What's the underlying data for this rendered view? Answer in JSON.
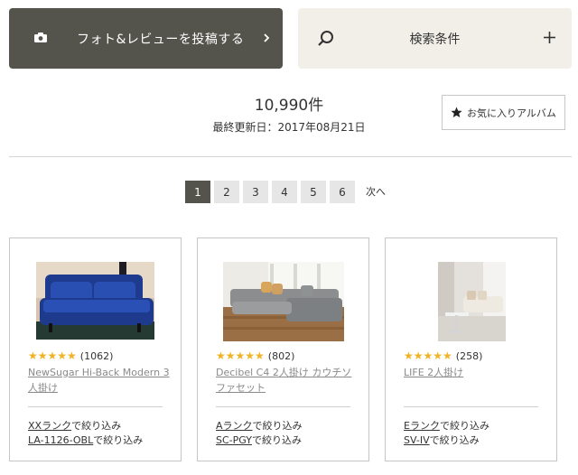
{
  "actions": {
    "post_label": "フォト&レビューを投稿する",
    "search_label": "検索条件"
  },
  "summary": {
    "count": "10,990件",
    "updated": "最終更新日：2017年08月21日",
    "album_label": "お気に入りアルバム"
  },
  "pagination": {
    "pages": [
      "1",
      "2",
      "3",
      "4",
      "5",
      "6"
    ],
    "current": "1",
    "next_label": "次へ"
  },
  "products": [
    {
      "stars": "★★★★★",
      "reviews": "(1062)",
      "name": "NewSugar Hi-Back Modern 3人掛け",
      "filter1_value": "XXランク",
      "filter2_value": "LA-1126-OBL",
      "filter_suffix": "で絞り込み"
    },
    {
      "stars": "★★★★★",
      "reviews": "(802)",
      "name": "Decibel C4 2人掛け カウチソファセット",
      "filter1_value": "Aランク",
      "filter2_value": "SC-PGY",
      "filter_suffix": "で絞り込み"
    },
    {
      "stars": "★★★★★",
      "reviews": "(258)",
      "name": "LIFE 2人掛け",
      "filter1_value": "Eランク",
      "filter2_value": "SV-IV",
      "filter_suffix": "で絞り込み"
    }
  ],
  "colors": {
    "primary_dark": "#55544c",
    "search_bg": "#f1efe8",
    "star": "#f0b323",
    "link_gray": "#8a8a8a"
  },
  "icons": [
    "camera-icon",
    "chevron-right-icon",
    "search-icon",
    "plus-icon",
    "star-icon"
  ]
}
